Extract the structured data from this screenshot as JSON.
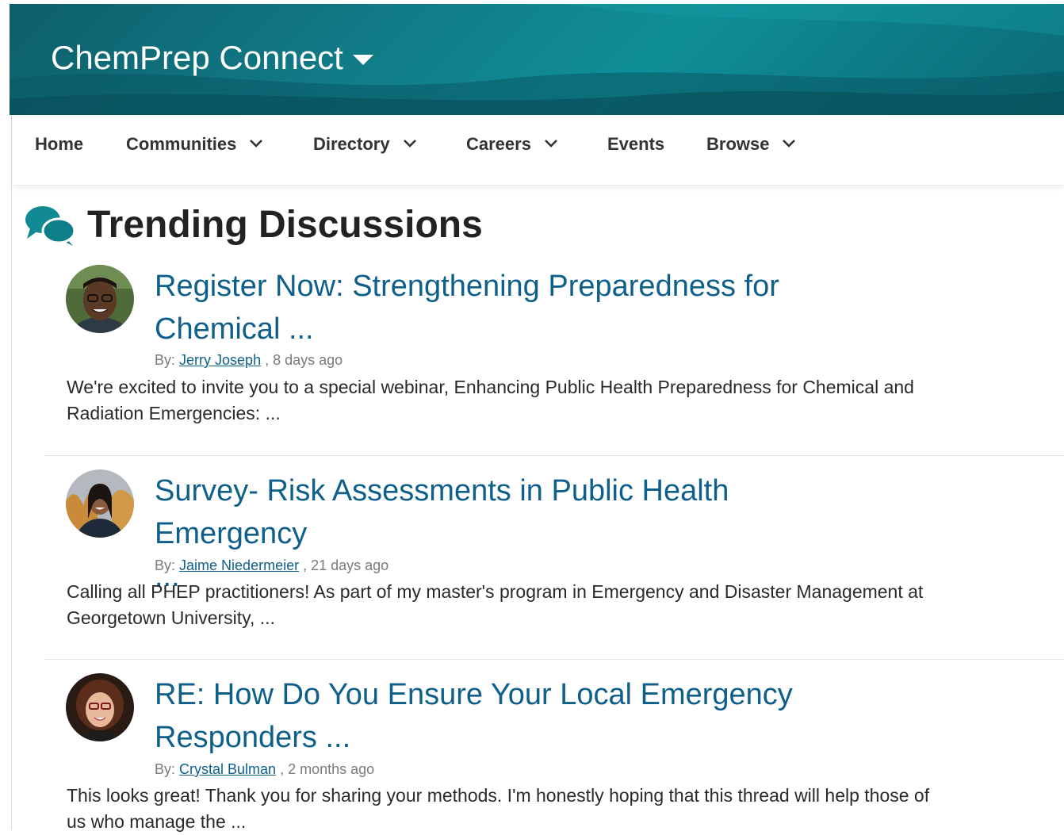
{
  "header": {
    "site_title": "ChemPrep Connect"
  },
  "nav": {
    "items": [
      {
        "label": "Home",
        "has_dropdown": false
      },
      {
        "label": "Communities",
        "has_dropdown": true
      },
      {
        "label": "Directory",
        "has_dropdown": true
      },
      {
        "label": "Careers",
        "has_dropdown": true
      },
      {
        "label": "Events",
        "has_dropdown": false
      },
      {
        "label": "Browse",
        "has_dropdown": true
      }
    ]
  },
  "section": {
    "title": "Trending Discussions",
    "icon": "chat-bubbles-icon"
  },
  "discussions": [
    {
      "title_line1": "Register Now: Strengthening Preparedness for",
      "title_line2": "Chemical ...",
      "by_label": "By:",
      "author": "Jerry Joseph",
      "time": ", 8 days ago",
      "excerpt_line1": "We're excited to invite you to a special webinar, Enhancing Public Health Preparedness for Chemical and",
      "excerpt_line2": "Radiation Emergencies: ..."
    },
    {
      "title_line1": "Survey- Risk Assessments in Public Health Emergency",
      "title_line2": "...",
      "by_label": "By:",
      "author": "Jaime Niedermeier",
      "time": ", 21 days ago",
      "excerpt_line1": "Calling all PHEP practitioners! As part of my master's program in Emergency and Disaster Management at",
      "excerpt_line2": "Georgetown University, ..."
    },
    {
      "title_line1": "RE: How Do You Ensure Your Local Emergency",
      "title_line2": "Responders ...",
      "by_label": "By:",
      "author": "Crystal Bulman",
      "time": ", 2 months ago",
      "excerpt_line1": "This looks great! Thank you for sharing your methods. I'm honestly hoping that this thread will help those of",
      "excerpt_line2": "us who manage the ..."
    }
  ],
  "colors": {
    "banner": "#0f7f8a",
    "link": "#0e5f8a",
    "icon": "#118a94"
  }
}
